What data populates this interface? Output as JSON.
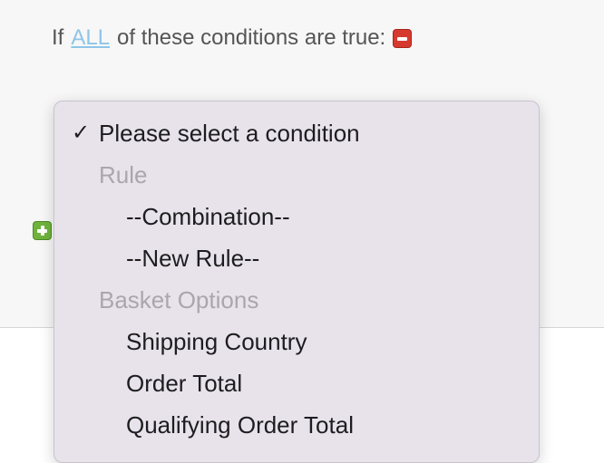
{
  "conditions": {
    "prefix": "If",
    "quantifier": "ALL",
    "suffix": "of these conditions are true:",
    "remove_icon": "remove-icon",
    "add_icon": "add-icon"
  },
  "dropdown": {
    "selected": {
      "label": "Please select a condition",
      "check": "✓"
    },
    "groups": [
      {
        "label": "Rule",
        "items": [
          "--Combination--",
          "--New Rule--"
        ]
      },
      {
        "label": "Basket Options",
        "items": [
          "Shipping Country",
          "Order Total",
          "Qualifying Order Total"
        ]
      }
    ]
  },
  "colors": {
    "link": "#8ec5e8",
    "remove": "#d63a2f",
    "add": "#6fb33e",
    "menu_bg": "#e8e3ea"
  }
}
